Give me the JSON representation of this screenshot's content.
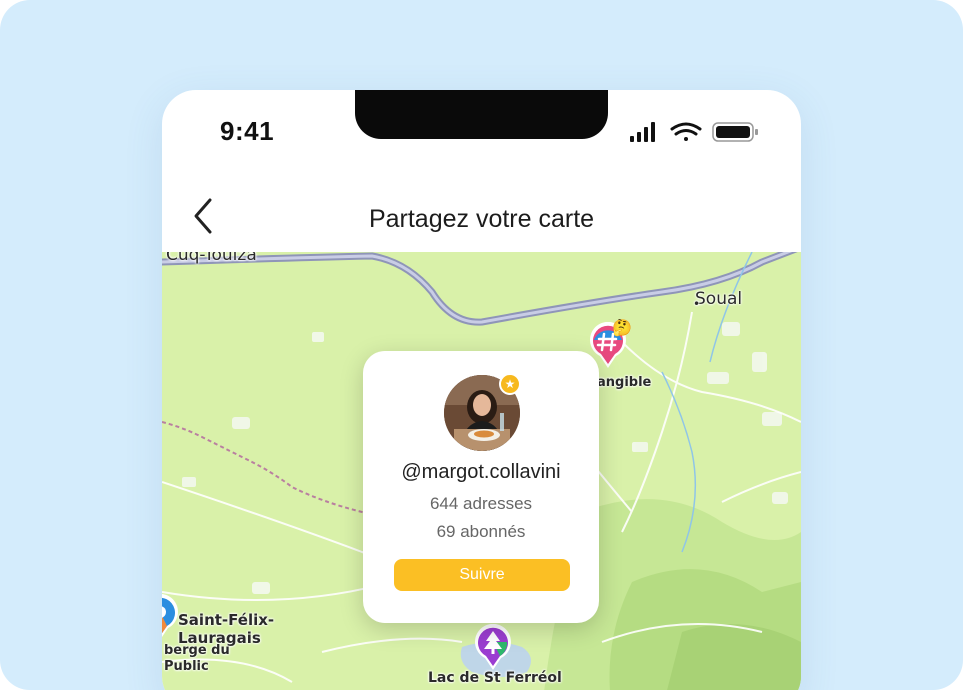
{
  "status_bar": {
    "time": "9:41"
  },
  "nav": {
    "title": "Partagez votre carte"
  },
  "map": {
    "labels": {
      "top_left": "Cuq-Toulza",
      "soual": "Soual",
      "tangible": "angible",
      "saint_felix_1": "Saint-Félix-",
      "saint_felix_2": "Lauragais",
      "auberge_1": "berge du",
      "auberge_2": "Public",
      "lac": "Lac de St Ferréol"
    },
    "pins": [
      {
        "name": "hashtag",
        "color": "#e84a7f",
        "icon": "hashtag-icon",
        "emoji": "🤔"
      },
      {
        "name": "tree",
        "color": "#9b3dd1",
        "icon": "tree-icon"
      },
      {
        "name": "edge",
        "color": "#2a8ee0",
        "icon": "map-pin-icon"
      }
    ]
  },
  "profile_card": {
    "username": "@margot.collavini",
    "addresses": "644 adresses",
    "followers": "69 abonnés",
    "follow_label": "Suivre",
    "accent": "#fbbf24"
  }
}
